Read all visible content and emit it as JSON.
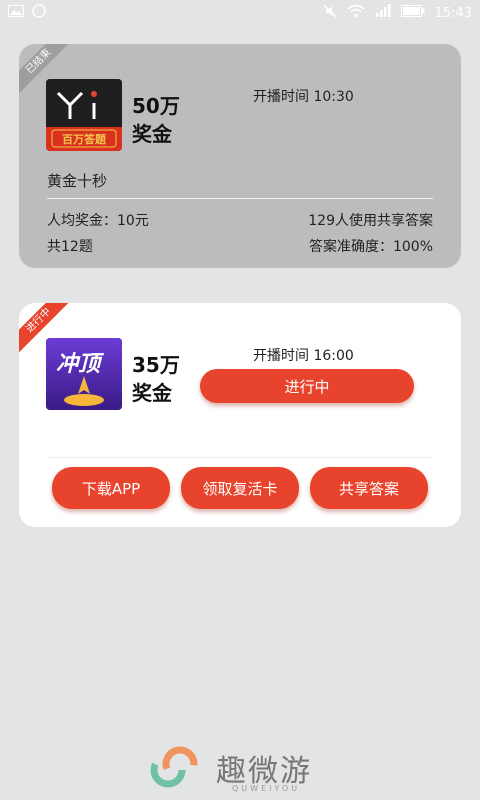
{
  "status_bar": {
    "time": "15:43"
  },
  "cards": [
    {
      "status_ribbon": "已结束",
      "prize_amount": "50万",
      "prize_label": "奖金",
      "start_time": "开播时间 10:30",
      "game_name": "黄金十秒",
      "logo_sub": "百万答题",
      "avg_prize": "人均奖金：10元",
      "users_sharing": "129人使用共享答案",
      "question_count": "共12题",
      "accuracy": "答案准确度：100%"
    },
    {
      "status_ribbon": "进行中",
      "prize_amount": "35万",
      "prize_label": "奖金",
      "start_time": "开播时间 16:00",
      "live_button": "进行中",
      "logo_text": "冲顶",
      "buttons": [
        "下载APP",
        "领取复活卡",
        "共享答案"
      ]
    }
  ],
  "brand": {
    "name": "趣微游",
    "sub": "QUWEIYOU"
  },
  "colors": {
    "accent": "#e8432c",
    "ended_card": "#bcbcbc",
    "background": "#e3e4e6"
  }
}
